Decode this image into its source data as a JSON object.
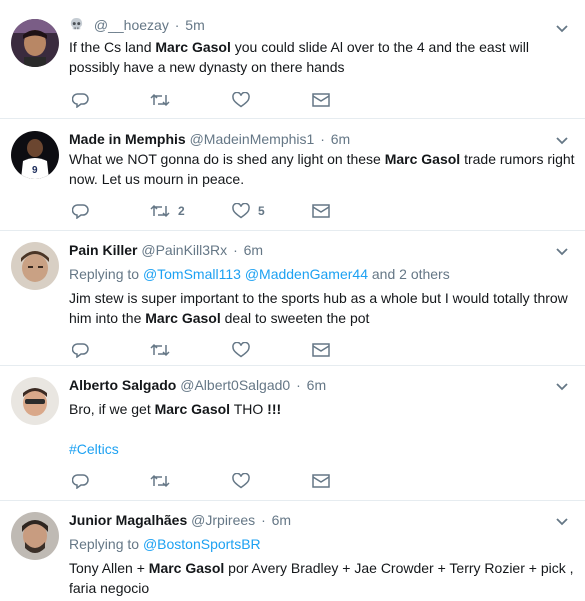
{
  "tweets": [
    {
      "name": "",
      "handle": "@__hoezay",
      "time": "5m",
      "text_before": "If the Cs land ",
      "text_bold": "Marc Gasol",
      "text_after": " you could slide Al over to the 4 and the east will possibly have a new dynasty on there hands",
      "reply_count": "",
      "retweet_count": "",
      "like_count": ""
    },
    {
      "name": "Made in Memphis",
      "handle": "@MadeinMemphis1",
      "time": "6m",
      "text_before": "What we NOT gonna do is shed any light on these ",
      "text_bold": "Marc Gasol",
      "text_after": " trade rumors right now. Let us mourn in peace.",
      "reply_count": "",
      "retweet_count": "2",
      "like_count": "5"
    },
    {
      "name": "Pain Killer",
      "handle": "@PainKill3Rx",
      "time": "6m",
      "reply_prefix": "Replying to ",
      "reply_user1": "@TomSmall113",
      "reply_user2": "@MaddenGamer44",
      "reply_suffix": " and 2 others",
      "text_before": "Jim stew is super important to the sports hub as a whole but I would totally throw him into the ",
      "text_bold": "Marc Gasol",
      "text_after": " deal to sweeten the pot",
      "reply_count": "",
      "retweet_count": "",
      "like_count": ""
    },
    {
      "name": "Alberto Salgado",
      "handle": "@Albert0Salgad0",
      "time": "6m",
      "text_before": "Bro, if we get ",
      "text_bold": "Marc Gasol",
      "text_after": " THO ",
      "text_bold2": "!!!",
      "hashtag": "#Celtics",
      "reply_count": "",
      "retweet_count": "",
      "like_count": ""
    },
    {
      "name": "Junior Magalhães",
      "handle": "@Jrpirees",
      "time": "6m",
      "reply_prefix": "Replying to ",
      "reply_user1": "@BostonSportsBR",
      "text_before": "Tony Allen + ",
      "text_bold": "Marc Gasol",
      "text_after": " por Avery Bradley + Jae Crowder + Terry Rozier + pick , faria negocio"
    }
  ],
  "icons": {
    "reply": "reply-icon",
    "retweet": "retweet-icon",
    "like": "heart-icon",
    "dm": "envelope-icon",
    "caret": "chevron-down-icon",
    "skull": "skull-icon"
  },
  "colors": {
    "link": "#1da1f2",
    "secondary_text": "#657786",
    "divider": "#e6ecf0"
  }
}
